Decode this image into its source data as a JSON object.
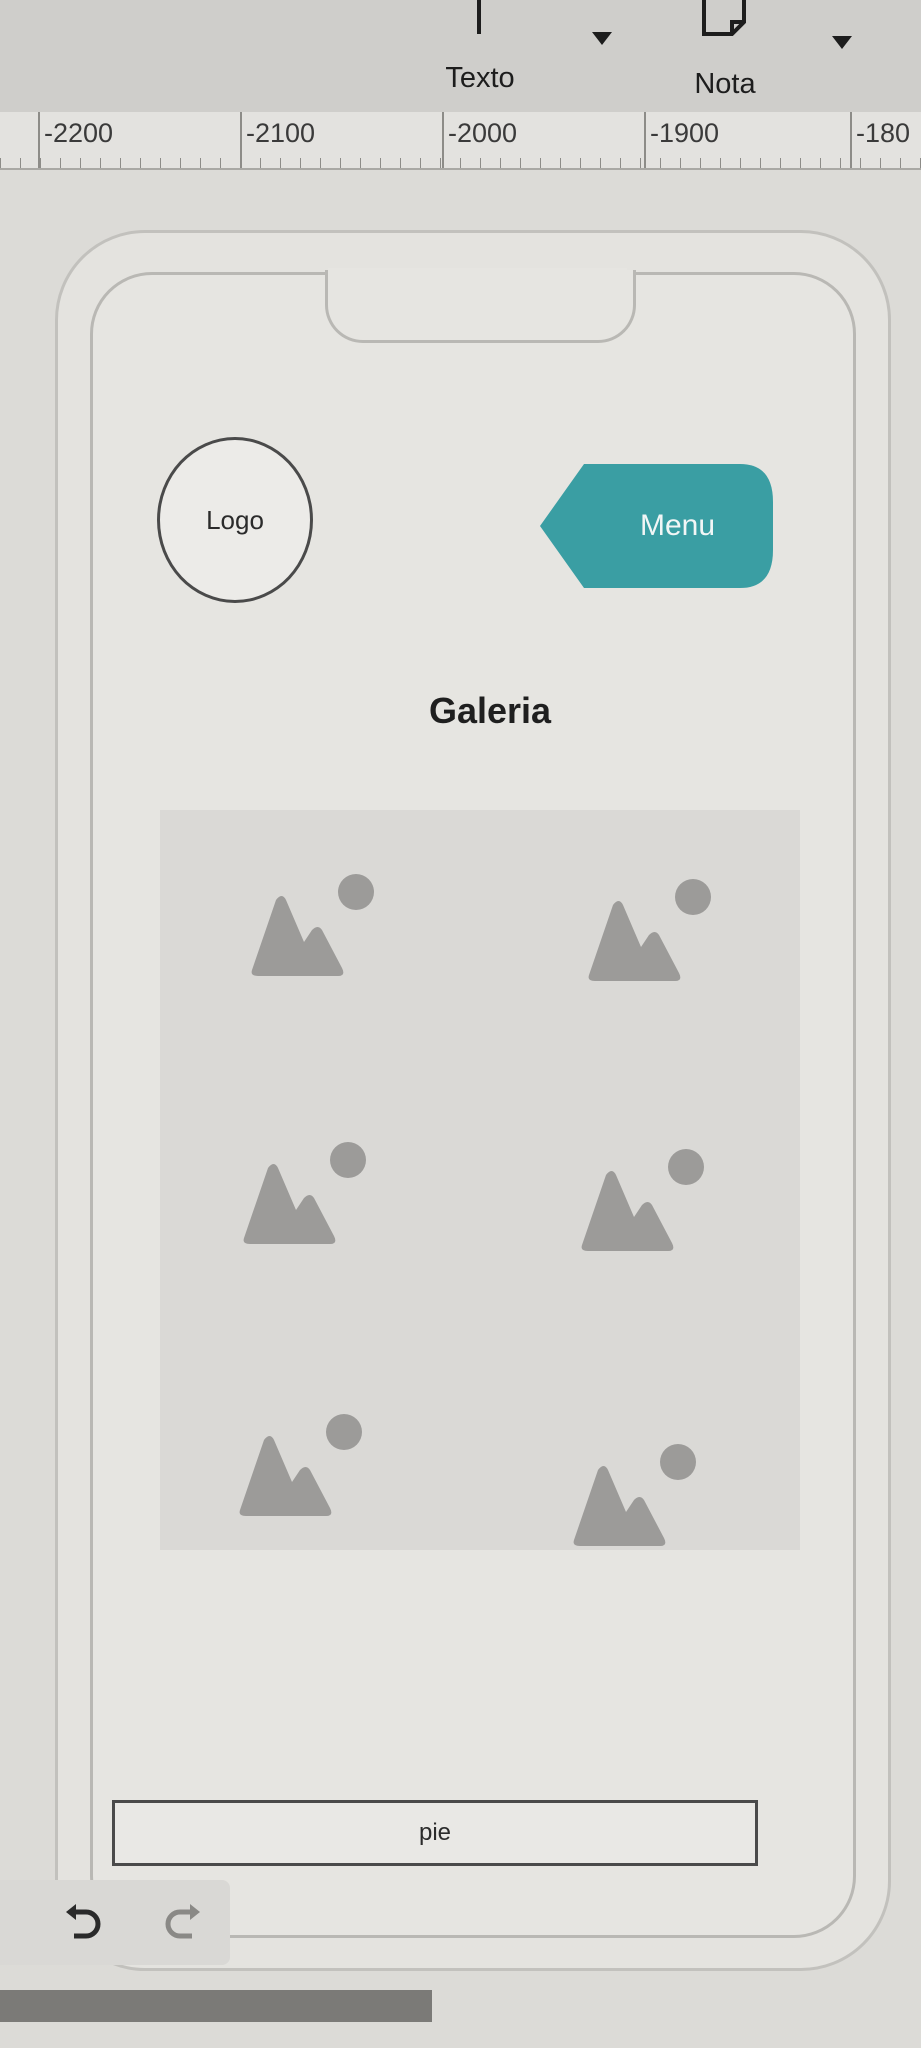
{
  "toolbar": {
    "text_tool_label": "Texto",
    "note_tool_label": "Nota"
  },
  "ruler": {
    "labels": [
      "-2200",
      "-2100",
      "-2000",
      "-1900",
      "-180"
    ]
  },
  "mockup": {
    "logo_label": "Logo",
    "menu_label": "Menu",
    "menu_color": "#3a9ea3",
    "page_title": "Galeria",
    "footer_label": "pie",
    "image_count": 6
  }
}
